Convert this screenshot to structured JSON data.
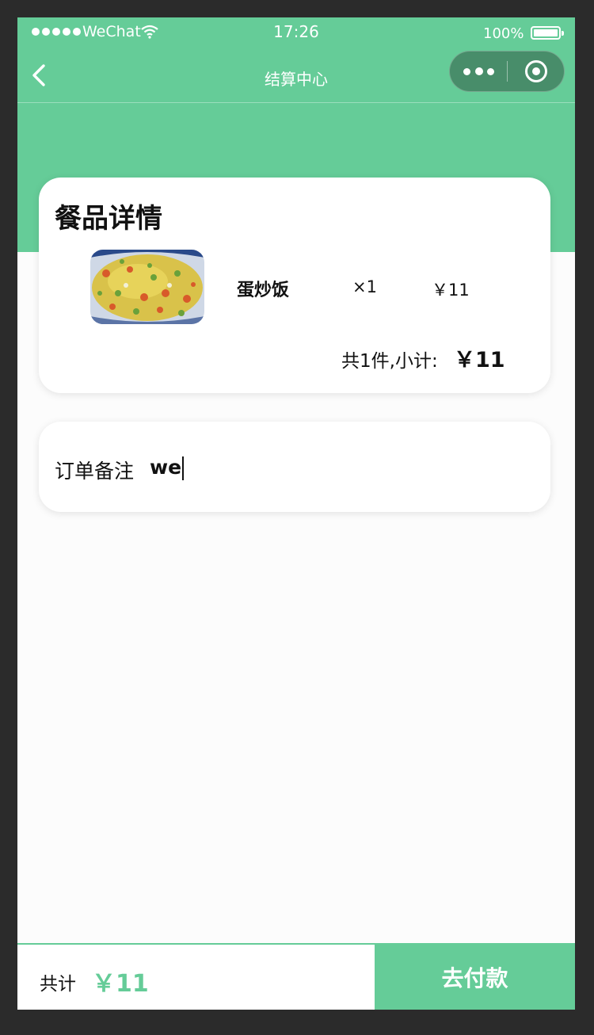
{
  "status_bar": {
    "carrier": "WeChat",
    "time": "17:26",
    "battery": "100%",
    "battery_level": 1.0
  },
  "nav": {
    "title": "结算中心",
    "icons": [
      "back-chevron-icon",
      "more-dots-icon",
      "close-target-icon"
    ]
  },
  "order_detail": {
    "title": "餐品详情",
    "items": [
      {
        "name": "蛋炒饭",
        "qty": "×1",
        "price": "￥11",
        "image": "fried-rice-photo"
      }
    ],
    "subtotal_label": "共1件,小计:",
    "subtotal_value": "￥11"
  },
  "note": {
    "label": "订单备注",
    "value": "we"
  },
  "footer": {
    "total_label": "共计",
    "total_value": "￥11",
    "pay_label": "去付款"
  },
  "colors": {
    "brand": "#65cc98",
    "text": "#111111",
    "background": "#fcfcfc"
  }
}
